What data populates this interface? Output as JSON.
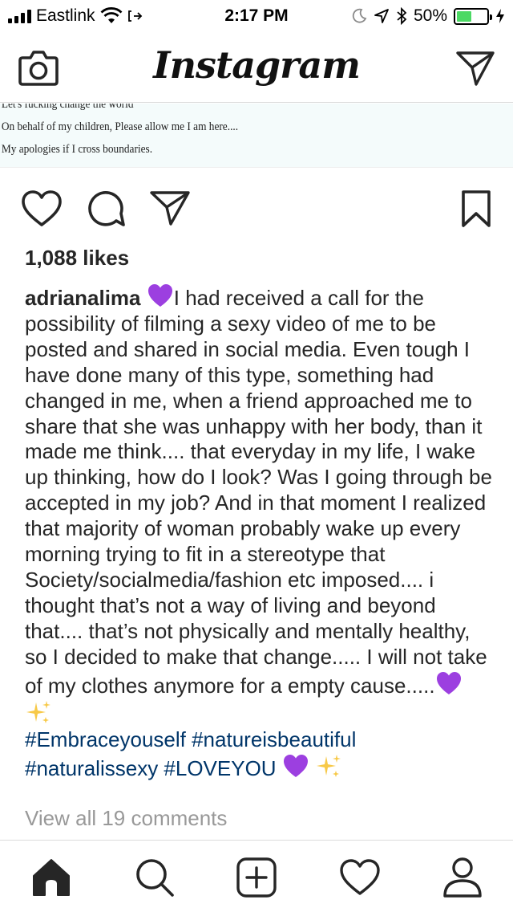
{
  "status_bar": {
    "carrier": "Eastlink",
    "time": "2:17 PM",
    "battery_percent": "50%",
    "battery_level": 0.5,
    "battery_color": "#4cd964"
  },
  "nav": {
    "logo": "Instagram",
    "camera_icon": "camera-icon",
    "direct_icon": "direct-message-icon"
  },
  "post_image": {
    "lines": [
      "Let's fucking change the world",
      "On behalf of my children, Please allow me I am here....",
      "My apologies if I cross boundaries."
    ]
  },
  "actions": {
    "like_icon": "heart-icon",
    "comment_icon": "comment-icon",
    "share_icon": "share-icon",
    "save_icon": "bookmark-icon"
  },
  "likes": "1,088 likes",
  "caption": {
    "username": "adrianalima",
    "text": "I had received a call for the possibility of filming a sexy video of me to be posted and shared in social media. Even tough I have done many of this type, something had changed in me, when a friend approached me to share that she was unhappy with her body, than it made me think.... that everyday in my life, I wake up thinking, how do I look? Was I going through be accepted in my job? And in that moment I realized that majority of woman probably wake up every morning trying to fit in a stereotype that Society/socialmedia/fashion etc imposed.... i thought that’s not a way of living and beyond that.... that’s not physically and mentally healthy, so I decided to make that change..... I will not take of my clothes anymore for a empty cause.....",
    "hashtags_line1": "#Embraceyouself #natureisbeautiful",
    "hashtags_line2": "#naturalissexy #LOVEYOU",
    "hashtag_color": "#003569"
  },
  "view_comments": "View all 19 comments",
  "tabbar": {
    "items": [
      "home-icon",
      "search-icon",
      "new-post-icon",
      "activity-icon",
      "profile-icon"
    ]
  }
}
